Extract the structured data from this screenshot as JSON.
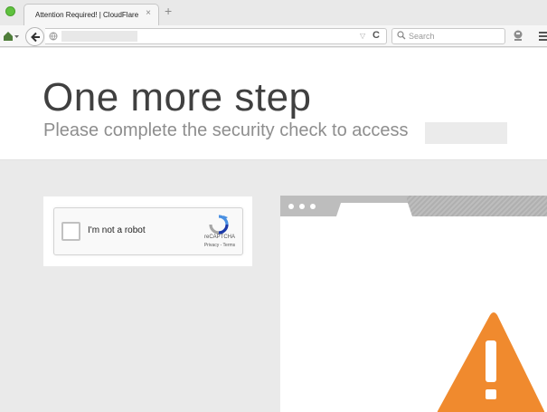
{
  "browser": {
    "tab_title": "Attention Required! | CloudFlare",
    "tab_close": "×",
    "new_tab": "+",
    "url_value": "",
    "reload_glyph": "C",
    "search_placeholder": "Search",
    "icons": [
      "home-icon",
      "dropdown-arrow-icon",
      "back-arrow-icon",
      "globe-icon",
      "url-dropmarker-icon",
      "reload-icon",
      "search-icon",
      "extension-icon",
      "hamburger-menu-icon"
    ]
  },
  "page": {
    "title": "One more step",
    "subtitle": "Please complete the security check to access",
    "site_name": ""
  },
  "captcha": {
    "label": "I'm not a robot",
    "brand": "reCAPTCHA",
    "links": "Privacy - Terms",
    "checked": false
  },
  "colors": {
    "warning_orange": "#f08a2e",
    "page_background": "#eaeaea",
    "window_frame": "#bdbdbd"
  }
}
